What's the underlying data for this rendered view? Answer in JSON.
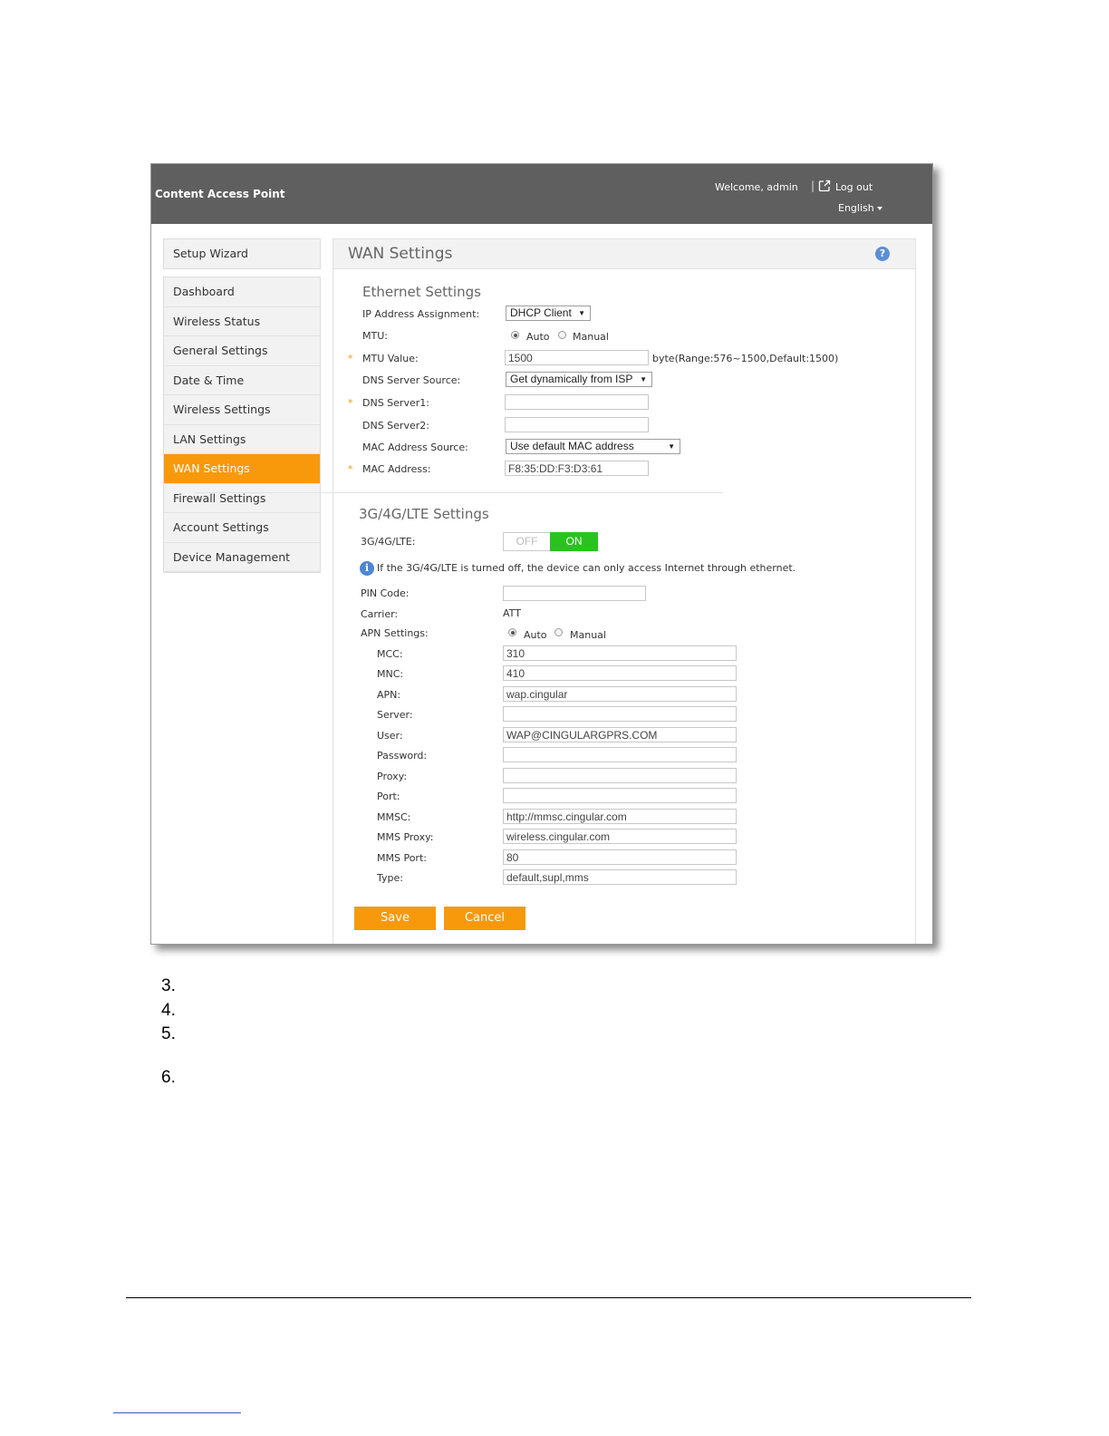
{
  "header": {
    "brand": "Content Access Point",
    "welcome": "Welcome, admin",
    "separator": "|",
    "logout": "Log out",
    "language": "English"
  },
  "sidebar": {
    "setup_wizard": "Setup Wizard",
    "items": [
      {
        "label": "Dashboard"
      },
      {
        "label": "Wireless Status"
      },
      {
        "label": "General Settings"
      },
      {
        "label": "Date & Time"
      },
      {
        "label": "Wireless Settings"
      },
      {
        "label": "LAN Settings"
      },
      {
        "label": "WAN Settings",
        "active": true
      },
      {
        "label": "Firewall Settings"
      },
      {
        "label": "Account Settings"
      },
      {
        "label": "Device Management"
      }
    ]
  },
  "panel": {
    "title": "WAN Settings",
    "help": "?"
  },
  "ethernet": {
    "heading": "Ethernet Settings",
    "ip_assignment_label": "IP Address Assignment:",
    "ip_assignment_value": "DHCP Client",
    "mtu_label": "MTU:",
    "mtu_auto": "Auto",
    "mtu_manual": "Manual",
    "mtu_value_label": "MTU Value:",
    "mtu_value": "1500",
    "mtu_hint": "byte(Range:576~1500,Default:1500)",
    "dns_source_label": "DNS Server Source:",
    "dns_source_value": "Get dynamically from ISP",
    "dns1_label": "DNS Server1:",
    "dns1_value": "",
    "dns2_label": "DNS Server2:",
    "dns2_value": "",
    "mac_source_label": "MAC Address Source:",
    "mac_source_value": "Use default MAC address",
    "mac_label": "MAC Address:",
    "mac_value": "F8:35:DD:F3:D3:61",
    "required_mark": "*"
  },
  "lte": {
    "heading": "3G/4G/LTE Settings",
    "toggle_label": "3G/4G/LTE:",
    "off": "OFF",
    "on": "ON",
    "info_icon": "i",
    "info": "If the 3G/4G/LTE is turned off, the device can only access Internet through ethernet.",
    "pin_label": "PIN Code:",
    "pin_value": "",
    "carrier_label": "Carrier:",
    "carrier_value": "ATT",
    "apn_settings_label": "APN Settings:",
    "apn_auto": "Auto",
    "apn_manual": "Manual",
    "fields": [
      {
        "label": "MCC:",
        "value": "310"
      },
      {
        "label": "MNC:",
        "value": "410"
      },
      {
        "label": "APN:",
        "value": "wap.cingular"
      },
      {
        "label": "Server:",
        "value": ""
      },
      {
        "label": "User:",
        "value": "WAP@CINGULARGPRS.COM"
      },
      {
        "label": "Password:",
        "value": ""
      },
      {
        "label": "Proxy:",
        "value": ""
      },
      {
        "label": "Port:",
        "value": ""
      },
      {
        "label": "MMSC:",
        "value": "http://mmsc.cingular.com"
      },
      {
        "label": "MMS Proxy:",
        "value": "wireless.cingular.com"
      },
      {
        "label": "MMS Port:",
        "value": "80"
      },
      {
        "label": "Type:",
        "value": "default,supl,mms"
      }
    ]
  },
  "buttons": {
    "save": "Save",
    "cancel": "Cancel"
  },
  "document": {
    "steps": [
      "3.",
      "4.",
      "5.",
      "6."
    ]
  }
}
